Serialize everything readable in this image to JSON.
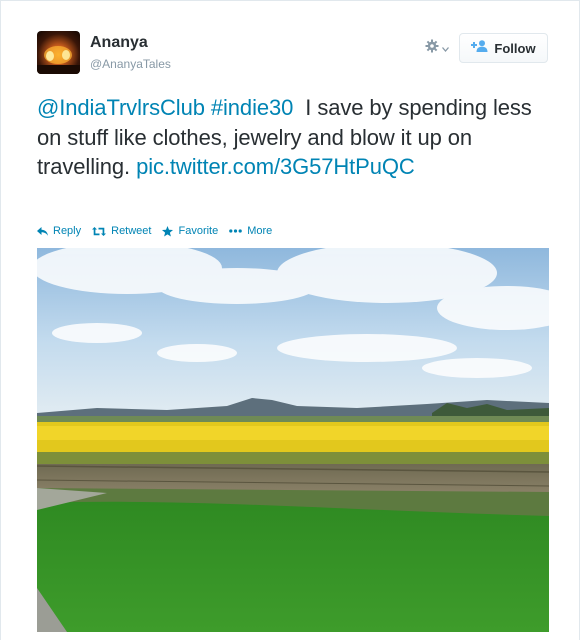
{
  "tweet": {
    "user": {
      "name": "Ananya",
      "handle": "@AnanyaTales",
      "avatar_icon": "avatar-image"
    },
    "follow_label": "Follow",
    "text": {
      "mention": "@IndiaTrvlrsClub",
      "hashtag": "#indie30",
      "body": "I save by spending less on stuff like clothes, jewelry and blow it up on travelling.",
      "pic_link": "pic.twitter.com/3G57HtPuQC"
    },
    "actions": {
      "reply": "Reply",
      "retweet": "Retweet",
      "favorite": "Favorite",
      "more": "More"
    },
    "colors": {
      "link": "#0084b4",
      "text": "#292f33",
      "muted": "#8899a6"
    },
    "icons": [
      "gear-icon",
      "chevron-down-icon",
      "follow-person-icon",
      "reply-icon",
      "retweet-icon",
      "star-icon",
      "more-icon"
    ]
  }
}
